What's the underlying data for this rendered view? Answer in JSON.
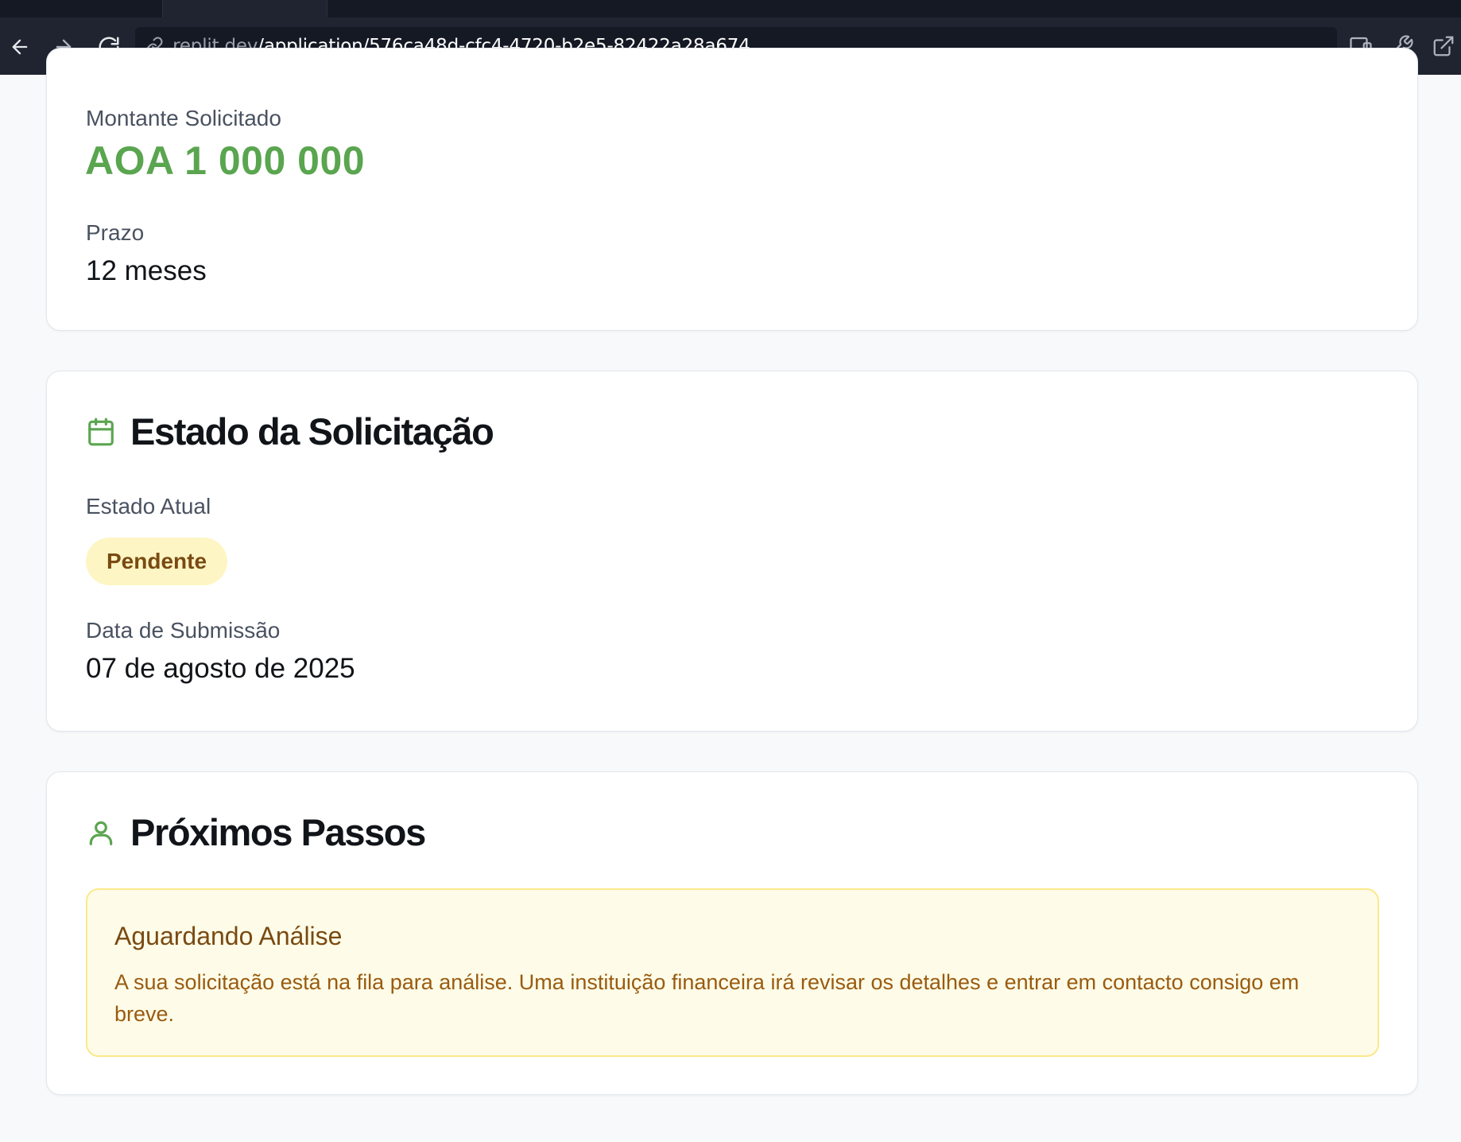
{
  "browser": {
    "url_domain": ".replit.dev",
    "url_path": "/application/576ca48d-cfc4-4720-b2e5-82422a28a674"
  },
  "loan": {
    "amount_label": "Montante Solicitado",
    "amount_value": "AOA 1 000 000",
    "term_label": "Prazo",
    "term_value": "12 meses"
  },
  "status": {
    "title": "Estado da Solicitação",
    "current_label": "Estado Atual",
    "badge": "Pendente",
    "date_label": "Data de Submissão",
    "date_value": "07 de agosto de 2025"
  },
  "next_steps": {
    "title": "Próximos Passos",
    "notice_title": "Aguardando Análise",
    "notice_body": "A sua solicitação está na fila para análise. Uma instituição financeira irá revisar os detalhes e entrar em contacto consigo em breve."
  },
  "colors": {
    "accent_green": "#5aa54f",
    "badge_bg": "#fdf6c4",
    "badge_text": "#7a4a12",
    "notice_border": "#fbe98a"
  },
  "icons": [
    "back-arrow-icon",
    "forward-arrow-icon",
    "reload-icon",
    "link-icon",
    "devices-icon",
    "wrench-icon",
    "external-link-icon",
    "calendar-icon",
    "user-icon"
  ]
}
